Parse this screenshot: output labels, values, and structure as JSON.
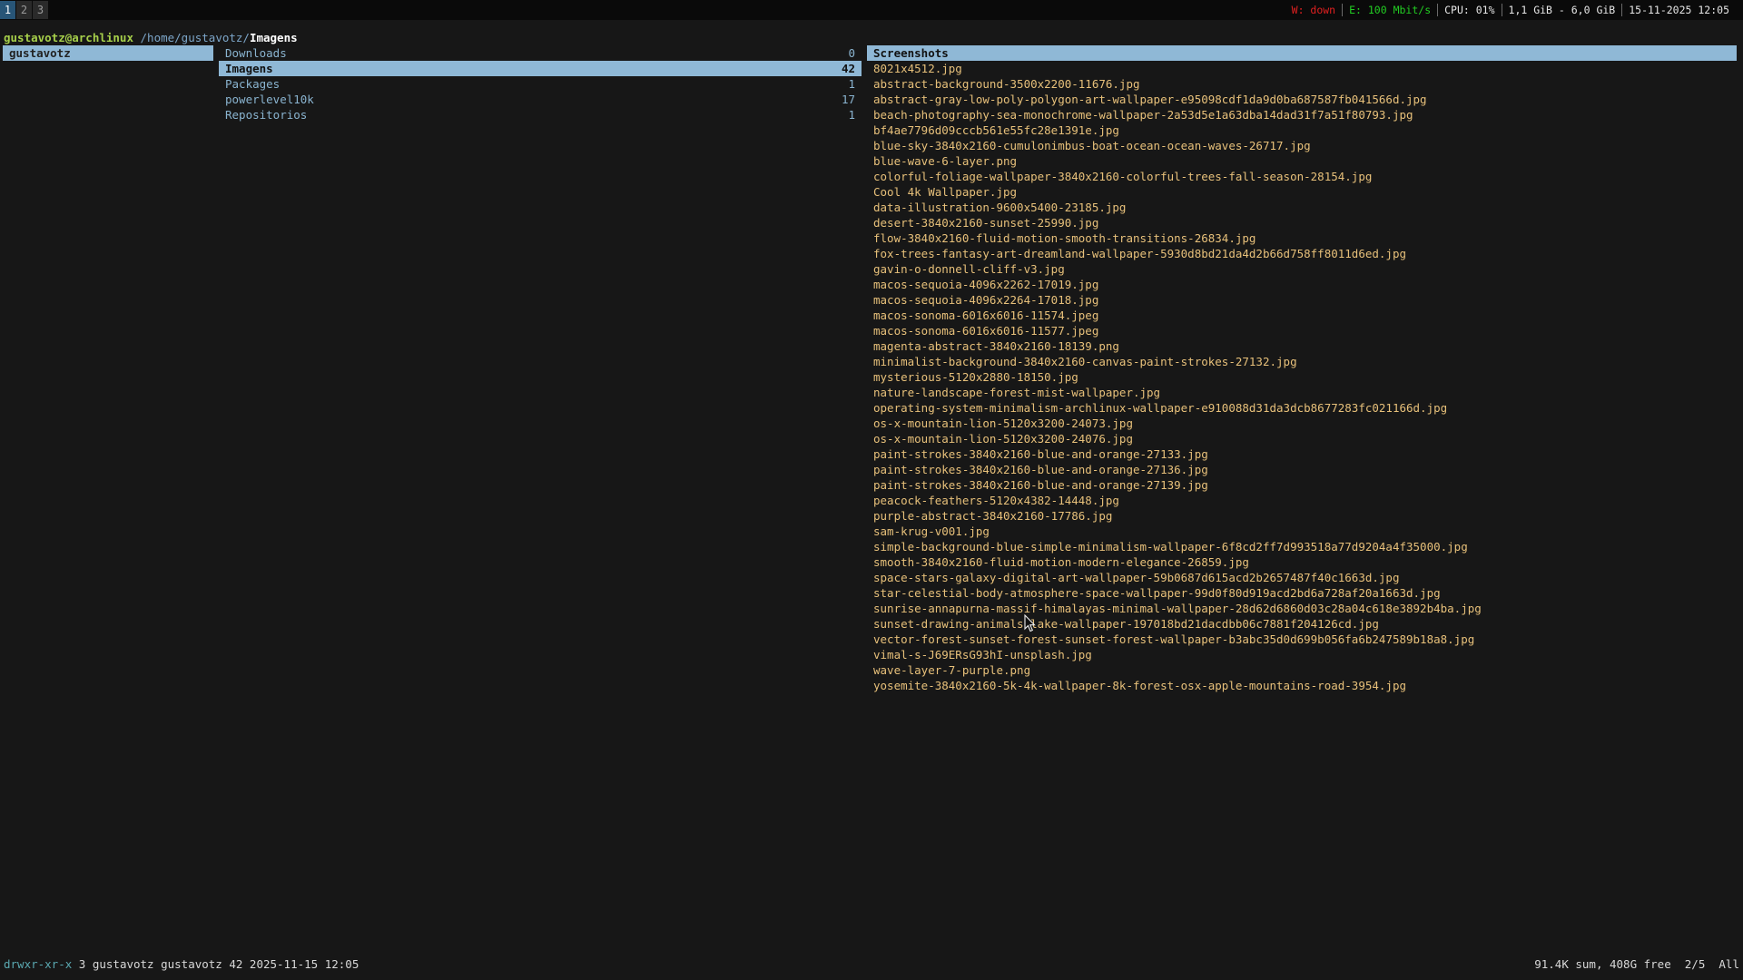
{
  "workspaces": [
    "1",
    "2",
    "3"
  ],
  "active_workspace": "1",
  "status": {
    "wifi": "W: down",
    "ethernet": "E: 100 Mbit/s",
    "cpu": "CPU: 01%",
    "memory": "1,1 GiB - 6,0 GiB",
    "datetime": "15-11-2025 12:05"
  },
  "path": {
    "host": "gustavotz@archlinux",
    "dir": "/home/gustavotz/",
    "current": "Imagens"
  },
  "parent_column": {
    "items": [
      "gustavotz"
    ]
  },
  "current_column": {
    "items": [
      {
        "name": "Downloads",
        "count": "0"
      },
      {
        "name": "Imagens",
        "count": "42"
      },
      {
        "name": "Packages",
        "count": "1"
      },
      {
        "name": "powerlevel10k",
        "count": "17"
      },
      {
        "name": "Repositorios",
        "count": "1"
      }
    ]
  },
  "preview_column": {
    "header": "Screenshots",
    "files": [
      "8021x4512.jpg",
      "abstract-background-3500x2200-11676.jpg",
      "abstract-gray-low-poly-polygon-art-wallpaper-e95098cdf1da9d0ba687587fb041566d.jpg",
      "beach-photography-sea-monochrome-wallpaper-2a53d5e1a63dba14dad31f7a51f80793.jpg",
      "bf4ae7796d09cccb561e55fc28e1391e.jpg",
      "blue-sky-3840x2160-cumulonimbus-boat-ocean-ocean-waves-26717.jpg",
      "blue-wave-6-layer.png",
      "colorful-foliage-wallpaper-3840x2160-colorful-trees-fall-season-28154.jpg",
      "Cool 4k Wallpaper.jpg",
      "data-illustration-9600x5400-23185.jpg",
      "desert-3840x2160-sunset-25990.jpg",
      "flow-3840x2160-fluid-motion-smooth-transitions-26834.jpg",
      "fox-trees-fantasy-art-dreamland-wallpaper-5930d8bd21da4d2b66d758ff8011d6ed.jpg",
      "gavin-o-donnell-cliff-v3.jpg",
      "macos-sequoia-4096x2262-17019.jpg",
      "macos-sequoia-4096x2264-17018.jpg",
      "macos-sonoma-6016x6016-11574.jpeg",
      "macos-sonoma-6016x6016-11577.jpeg",
      "magenta-abstract-3840x2160-18139.png",
      "minimalist-background-3840x2160-canvas-paint-strokes-27132.jpg",
      "mysterious-5120x2880-18150.jpg",
      "nature-landscape-forest-mist-wallpaper.jpg",
      "operating-system-minimalism-archlinux-wallpaper-e910088d31da3dcb8677283fc021166d.jpg",
      "os-x-mountain-lion-5120x3200-24073.jpg",
      "os-x-mountain-lion-5120x3200-24076.jpg",
      "paint-strokes-3840x2160-blue-and-orange-27133.jpg",
      "paint-strokes-3840x2160-blue-and-orange-27136.jpg",
      "paint-strokes-3840x2160-blue-and-orange-27139.jpg",
      "peacock-feathers-5120x4382-14448.jpg",
      "purple-abstract-3840x2160-17786.jpg",
      "sam-krug-v001.jpg",
      "simple-background-blue-simple-minimalism-wallpaper-6f8cd2ff7d993518a77d9204a4f35000.jpg",
      "smooth-3840x2160-fluid-motion-modern-elegance-26859.jpg",
      "space-stars-galaxy-digital-art-wallpaper-59b0687d615acd2b2657487f40c1663d.jpg",
      "star-celestial-body-atmosphere-space-wallpaper-99d0f80d919acd2bd6a728af20a1663d.jpg",
      "sunrise-annapurna-massif-himalayas-minimal-wallpaper-28d62d6860d03c28a04c618e3892b4ba.jpg",
      "sunset-drawing-animals-lake-wallpaper-197018bd21dacdbb06c7881f204126cd.jpg",
      "vector-forest-sunset-forest-sunset-forest-wallpaper-b3abc35d0d699b056fa6b247589b18a8.jpg",
      "vimal-s-J69ERsG93hI-unsplash.jpg",
      "wave-layer-7-purple.png",
      "yosemite-3840x2160-5k-4k-wallpaper-8k-forest-osx-apple-mountains-road-3954.jpg"
    ]
  },
  "statusline": {
    "permissions": "drwxr-xr-x",
    "info": " 3 gustavotz gustavotz 42 2025-11-15 12:05",
    "right": "91.4K sum, 408G free  2/5  All"
  },
  "colors": {
    "background": "#171717",
    "selection": "#8fb8d6",
    "directory": "#8ab4d0",
    "file": "#e7c07a",
    "host": "#a6cf4a",
    "active_workspace": "#285577"
  }
}
